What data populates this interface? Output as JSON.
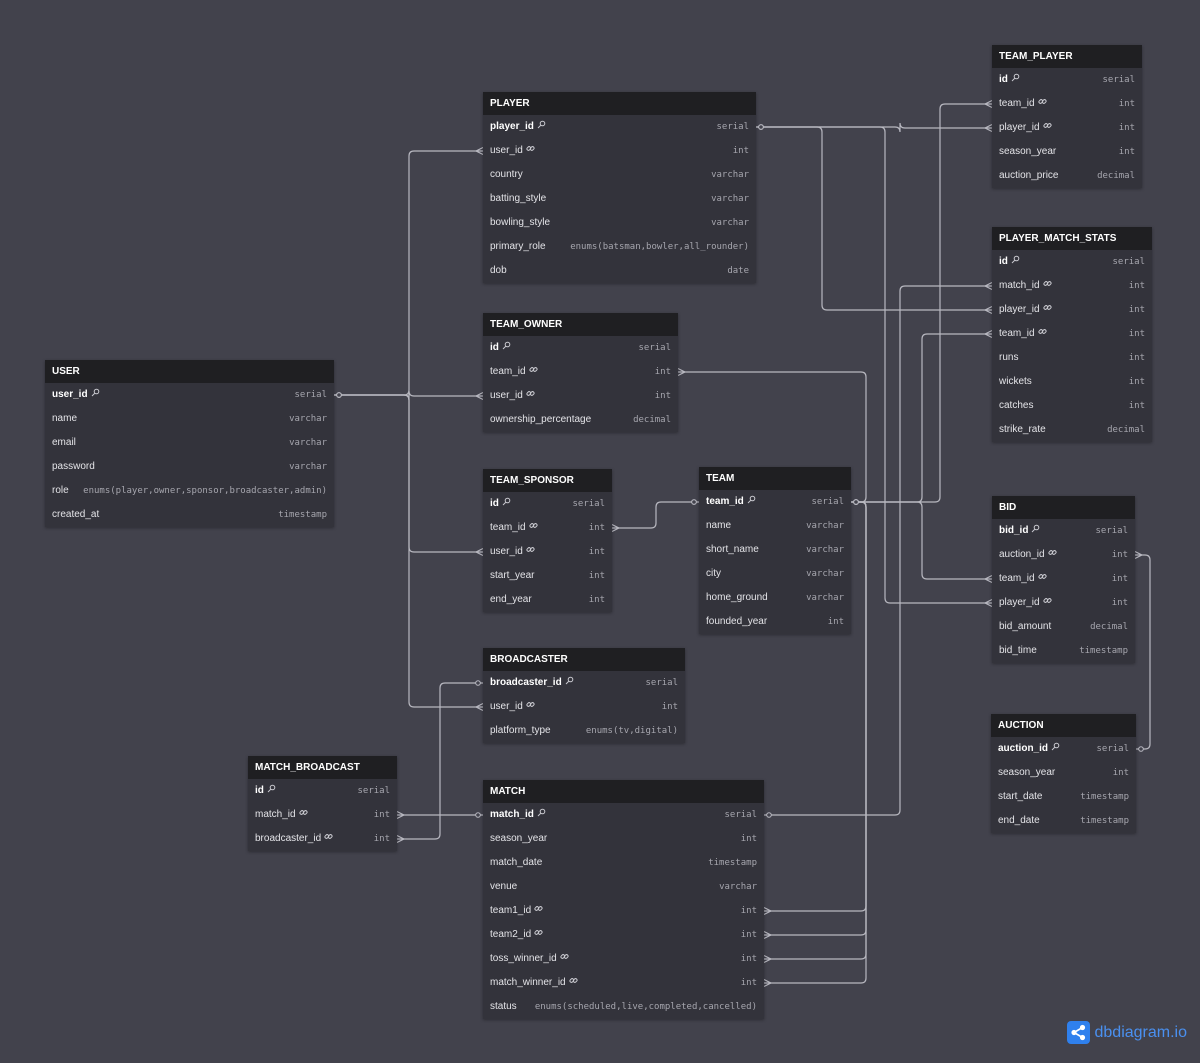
{
  "brand": {
    "logo_text": "dbdiagram.io",
    "accent": "#2f80ed"
  },
  "colors": {
    "background": "#42424c",
    "header": "#1f1f22",
    "table": "#33333b",
    "link": "#b8b8c0"
  },
  "tables": [
    {
      "id": "team_player",
      "name": "TEAM_PLAYER",
      "fields": [
        {
          "name": "id",
          "type": "serial",
          "key": "pk"
        },
        {
          "name": "team_id",
          "type": "int",
          "key": "fk"
        },
        {
          "name": "player_id",
          "type": "int",
          "key": "fk"
        },
        {
          "name": "season_year",
          "type": "int"
        },
        {
          "name": "auction_price",
          "type": "decimal"
        }
      ]
    },
    {
      "id": "player",
      "name": "PLAYER",
      "fields": [
        {
          "name": "player_id",
          "type": "serial",
          "key": "pk"
        },
        {
          "name": "user_id",
          "type": "int",
          "key": "fk"
        },
        {
          "name": "country",
          "type": "varchar"
        },
        {
          "name": "batting_style",
          "type": "varchar"
        },
        {
          "name": "bowling_style",
          "type": "varchar"
        },
        {
          "name": "primary_role",
          "type": "enums(batsman,bowler,all_rounder)"
        },
        {
          "name": "dob",
          "type": "date"
        }
      ]
    },
    {
      "id": "player_match_stats",
      "name": "PLAYER_MATCH_STATS",
      "fields": [
        {
          "name": "id",
          "type": "serial",
          "key": "pk"
        },
        {
          "name": "match_id",
          "type": "int",
          "key": "fk"
        },
        {
          "name": "player_id",
          "type": "int",
          "key": "fk"
        },
        {
          "name": "team_id",
          "type": "int",
          "key": "fk"
        },
        {
          "name": "runs",
          "type": "int"
        },
        {
          "name": "wickets",
          "type": "int"
        },
        {
          "name": "catches",
          "type": "int"
        },
        {
          "name": "strike_rate",
          "type": "decimal"
        }
      ]
    },
    {
      "id": "team_owner",
      "name": "TEAM_OWNER",
      "fields": [
        {
          "name": "id",
          "type": "serial",
          "key": "pk"
        },
        {
          "name": "team_id",
          "type": "int",
          "key": "fk"
        },
        {
          "name": "user_id",
          "type": "int",
          "key": "fk"
        },
        {
          "name": "ownership_percentage",
          "type": "decimal"
        }
      ]
    },
    {
      "id": "user",
      "name": "USER",
      "fields": [
        {
          "name": "user_id",
          "type": "serial",
          "key": "pk"
        },
        {
          "name": "name",
          "type": "varchar"
        },
        {
          "name": "email",
          "type": "varchar"
        },
        {
          "name": "password",
          "type": "varchar"
        },
        {
          "name": "role",
          "type": "enums(player,owner,sponsor,broadcaster,admin)"
        },
        {
          "name": "created_at",
          "type": "timestamp"
        }
      ]
    },
    {
      "id": "team_sponsor",
      "name": "TEAM_SPONSOR",
      "fields": [
        {
          "name": "id",
          "type": "serial",
          "key": "pk"
        },
        {
          "name": "team_id",
          "type": "int",
          "key": "fk"
        },
        {
          "name": "user_id",
          "type": "int",
          "key": "fk"
        },
        {
          "name": "start_year",
          "type": "int"
        },
        {
          "name": "end_year",
          "type": "int"
        }
      ]
    },
    {
      "id": "team",
      "name": "TEAM",
      "fields": [
        {
          "name": "team_id",
          "type": "serial",
          "key": "pk"
        },
        {
          "name": "name",
          "type": "varchar"
        },
        {
          "name": "short_name",
          "type": "varchar"
        },
        {
          "name": "city",
          "type": "varchar"
        },
        {
          "name": "home_ground",
          "type": "varchar"
        },
        {
          "name": "founded_year",
          "type": "int"
        }
      ]
    },
    {
      "id": "bid",
      "name": "BID",
      "fields": [
        {
          "name": "bid_id",
          "type": "serial",
          "key": "pk"
        },
        {
          "name": "auction_id",
          "type": "int",
          "key": "fk"
        },
        {
          "name": "team_id",
          "type": "int",
          "key": "fk"
        },
        {
          "name": "player_id",
          "type": "int",
          "key": "fk"
        },
        {
          "name": "bid_amount",
          "type": "decimal"
        },
        {
          "name": "bid_time",
          "type": "timestamp"
        }
      ]
    },
    {
      "id": "broadcaster",
      "name": "BROADCASTER",
      "fields": [
        {
          "name": "broadcaster_id",
          "type": "serial",
          "key": "pk"
        },
        {
          "name": "user_id",
          "type": "int",
          "key": "fk"
        },
        {
          "name": "platform_type",
          "type": "enums(tv,digital)"
        }
      ]
    },
    {
      "id": "auction",
      "name": "AUCTION",
      "fields": [
        {
          "name": "auction_id",
          "type": "serial",
          "key": "pk"
        },
        {
          "name": "season_year",
          "type": "int"
        },
        {
          "name": "start_date",
          "type": "timestamp"
        },
        {
          "name": "end_date",
          "type": "timestamp"
        }
      ]
    },
    {
      "id": "match_broadcast",
      "name": "MATCH_BROADCAST",
      "fields": [
        {
          "name": "id",
          "type": "serial",
          "key": "pk"
        },
        {
          "name": "match_id",
          "type": "int",
          "key": "fk"
        },
        {
          "name": "broadcaster_id",
          "type": "int",
          "key": "fk"
        }
      ]
    },
    {
      "id": "match",
      "name": "MATCH",
      "fields": [
        {
          "name": "match_id",
          "type": "serial",
          "key": "pk"
        },
        {
          "name": "season_year",
          "type": "int"
        },
        {
          "name": "match_date",
          "type": "timestamp"
        },
        {
          "name": "venue",
          "type": "varchar"
        },
        {
          "name": "team1_id",
          "type": "int",
          "key": "fk"
        },
        {
          "name": "team2_id",
          "type": "int",
          "key": "fk"
        },
        {
          "name": "toss_winner_id",
          "type": "int",
          "key": "fk"
        },
        {
          "name": "match_winner_id",
          "type": "int",
          "key": "fk"
        },
        {
          "name": "status",
          "type": "enums(scheduled,live,completed,cancelled)"
        }
      ]
    }
  ],
  "relations": [
    {
      "from": "user.user_id",
      "to": "player.user_id"
    },
    {
      "from": "user.user_id",
      "to": "team_owner.user_id"
    },
    {
      "from": "user.user_id",
      "to": "team_sponsor.user_id"
    },
    {
      "from": "user.user_id",
      "to": "broadcaster.user_id"
    },
    {
      "from": "team.team_id",
      "to": "team_sponsor.team_id"
    },
    {
      "from": "team.team_id",
      "to": "team_owner.team_id"
    },
    {
      "from": "team.team_id",
      "to": "team_player.team_id"
    },
    {
      "from": "team.team_id",
      "to": "player_match_stats.team_id"
    },
    {
      "from": "team.team_id",
      "to": "bid.team_id"
    },
    {
      "from": "team.team_id",
      "to": "match.team1_id"
    },
    {
      "from": "team.team_id",
      "to": "match.team2_id"
    },
    {
      "from": "team.team_id",
      "to": "match.toss_winner_id"
    },
    {
      "from": "team.team_id",
      "to": "match.match_winner_id"
    },
    {
      "from": "player.player_id",
      "to": "team_player.player_id"
    },
    {
      "from": "player.player_id",
      "to": "player_match_stats.player_id"
    },
    {
      "from": "player.player_id",
      "to": "bid.player_id"
    },
    {
      "from": "match.match_id",
      "to": "player_match_stats.match_id"
    },
    {
      "from": "match.match_id",
      "to": "match_broadcast.match_id"
    },
    {
      "from": "broadcaster.broadcaster_id",
      "to": "match_broadcast.broadcaster_id"
    },
    {
      "from": "auction.auction_id",
      "to": "bid.auction_id"
    }
  ]
}
